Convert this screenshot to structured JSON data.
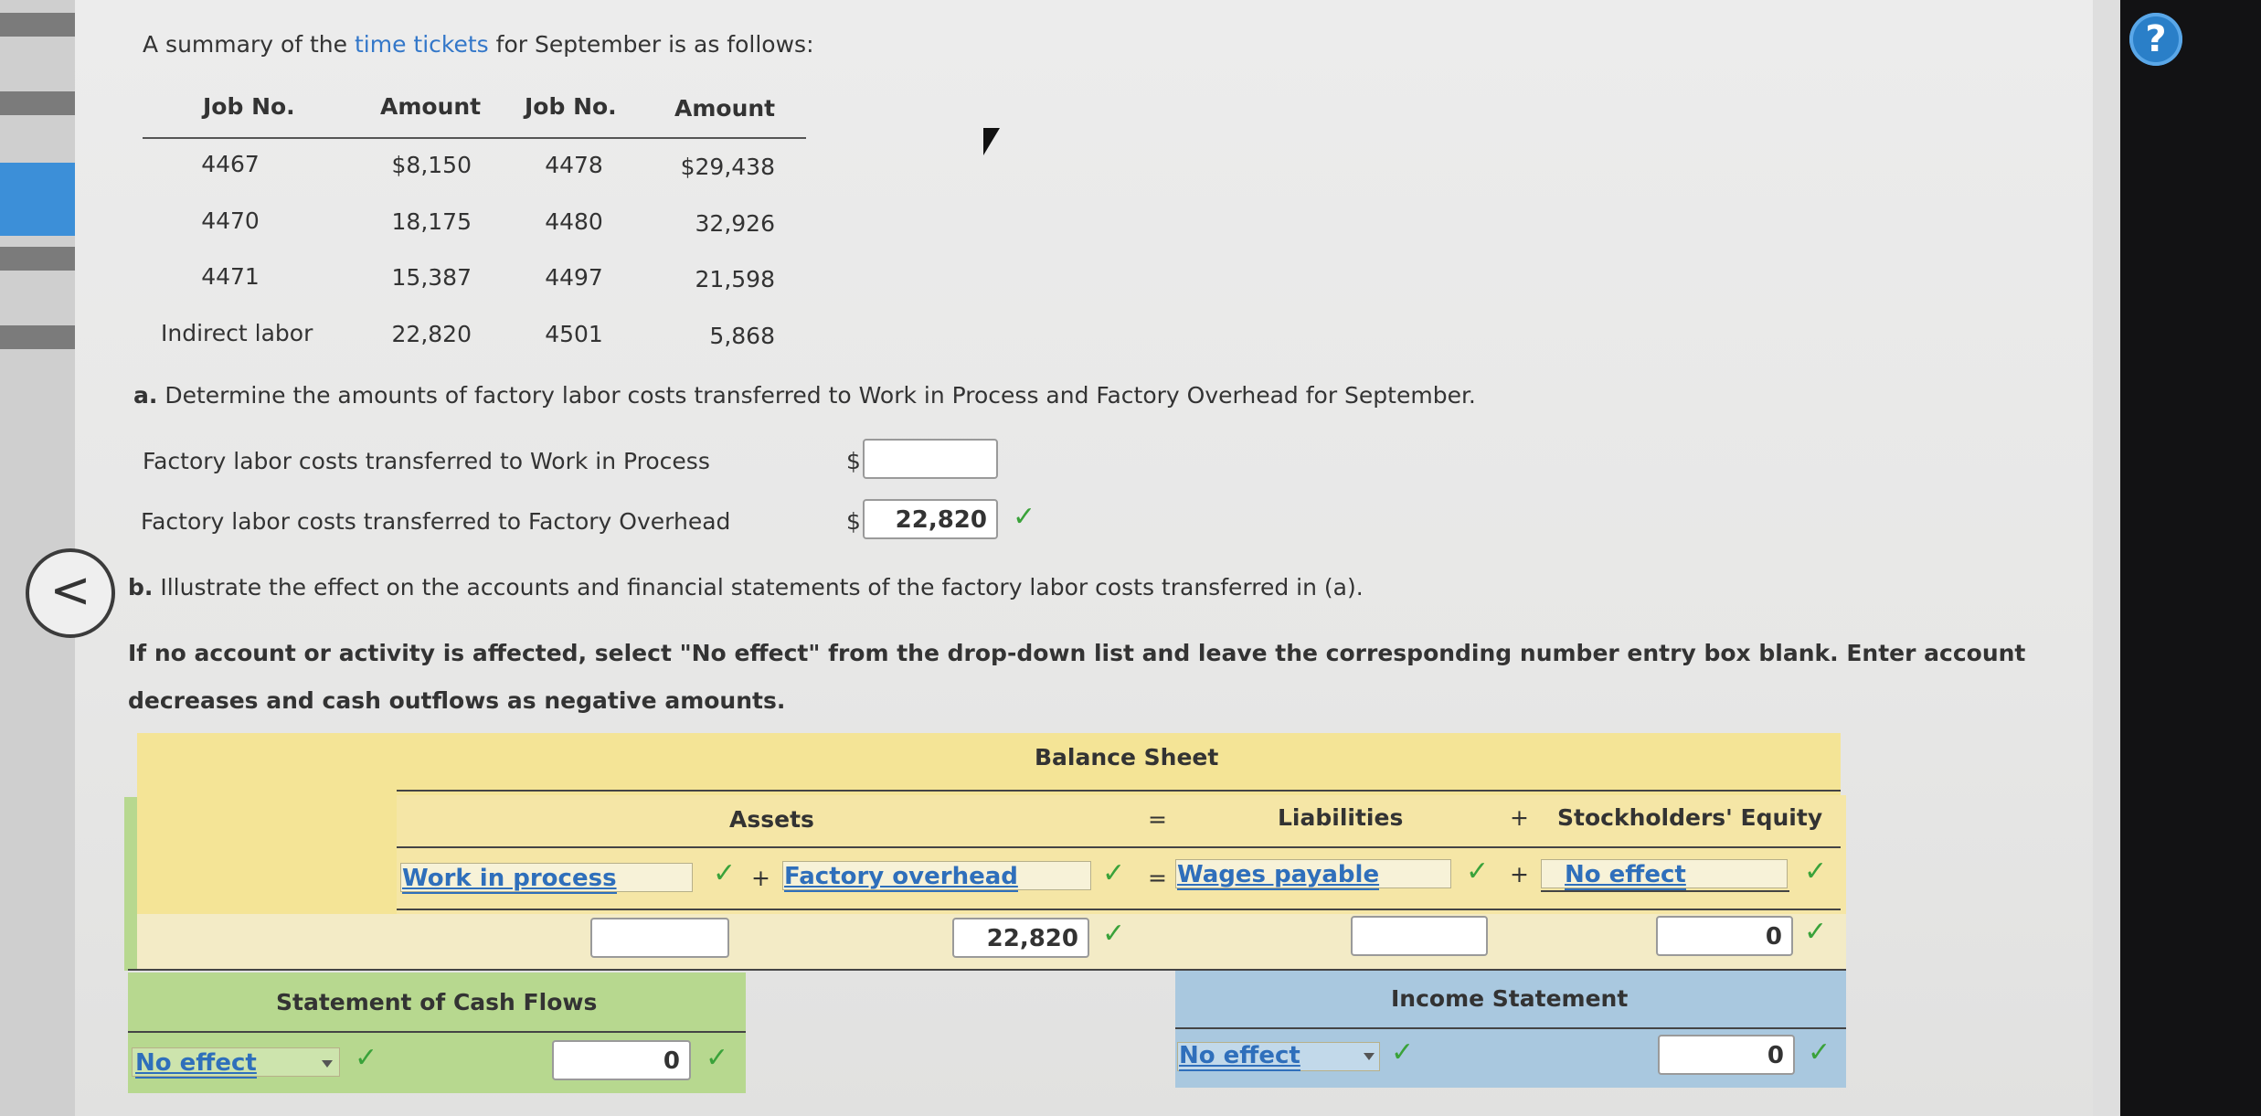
{
  "intro": {
    "prefix": "A summary of the ",
    "link": "time tickets",
    "suffix": " for September is as follows:"
  },
  "summary_table": {
    "headers": [
      "Job No.",
      "Amount",
      "Job No.",
      "Amount"
    ],
    "rows": [
      [
        "4467",
        "$8,150",
        "4478",
        "$29,438"
      ],
      [
        "4470",
        "18,175",
        "4480",
        "32,926"
      ],
      [
        "4471",
        "15,387",
        "4497",
        "21,598"
      ],
      [
        "Indirect labor",
        "22,820",
        "4501",
        "5,868"
      ]
    ]
  },
  "part_a": {
    "letter": "a.",
    "question": "Determine the amounts of factory labor costs transferred to Work in Process and Factory Overhead for September.",
    "rows": [
      {
        "label": "Factory labor costs transferred to Work in Process",
        "currency": "$",
        "value": ""
      },
      {
        "label": "Factory labor costs transferred to Factory Overhead",
        "currency": "$",
        "value": "22,820"
      }
    ]
  },
  "part_b": {
    "letter": "b.",
    "question": "Illustrate the effect on the accounts and financial statements of the factory labor costs transferred in (a).",
    "instruction_line1": "If no account or activity is affected, select \"No effect\" from the drop-down list and leave the corresponding number entry box blank. Enter account",
    "instruction_line2": "decreases and cash outflows as negative amounts."
  },
  "balance_sheet": {
    "title": "Balance Sheet",
    "assets": "Assets",
    "equals": "=",
    "liabilities": "Liabilities",
    "plus": "+",
    "equity": "Stockholders' Equity",
    "accounts": {
      "asset1": "Work in process",
      "asset2": "Factory overhead",
      "liability": "Wages payable",
      "equity": "No effect"
    },
    "values": {
      "asset1": "",
      "asset2": "22,820",
      "liability": "",
      "equity": "0"
    }
  },
  "cash_flows": {
    "title": "Statement of Cash Flows",
    "activity": "No effect",
    "value": "0"
  },
  "income_statement": {
    "title": "Income Statement",
    "account": "No effect",
    "value": "0"
  },
  "icons": {
    "check": "✓",
    "help": "?",
    "back": "<"
  },
  "colors": {
    "check": "#3aa23a",
    "link": "#3377c9",
    "balance_sheet": "#f4e496",
    "cash_flows": "#b7d88f",
    "income_statement": "#a9c8df"
  }
}
